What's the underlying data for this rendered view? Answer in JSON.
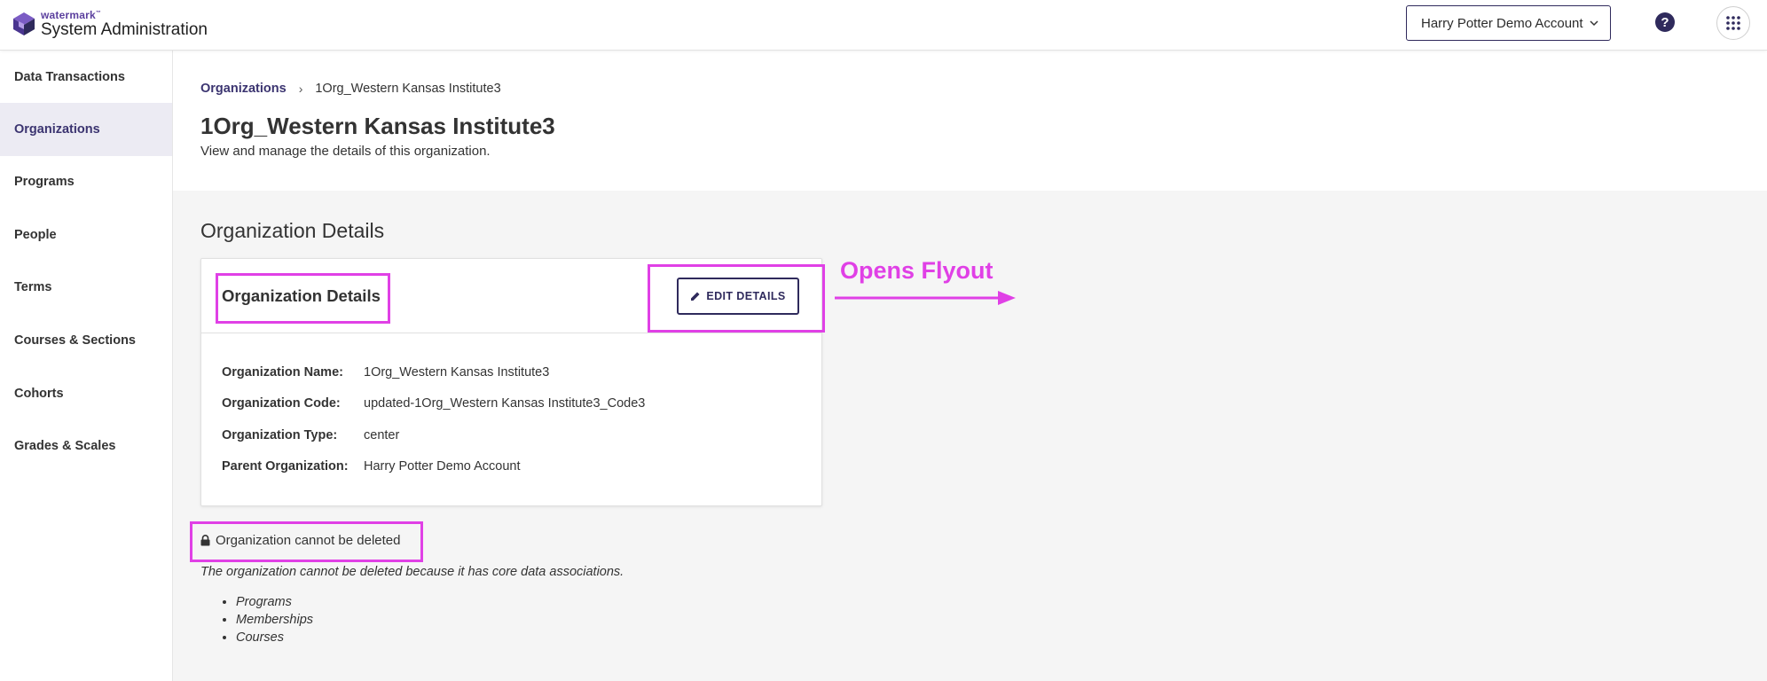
{
  "header": {
    "brand_small": "watermark",
    "brand_tm": "™",
    "brand_title": "System Administration",
    "account_selector": "Harry Potter Demo Account",
    "help_label": "?"
  },
  "sidebar": {
    "items": [
      {
        "label": "Data Transactions",
        "active": false
      },
      {
        "label": "Organizations",
        "active": true
      },
      {
        "label": "Programs",
        "active": false
      },
      {
        "label": "People",
        "active": false
      },
      {
        "label": "Terms",
        "active": false
      },
      {
        "label": "Courses & Sections",
        "active": false
      },
      {
        "label": "Cohorts",
        "active": false
      },
      {
        "label": "Grades & Scales",
        "active": false
      }
    ]
  },
  "breadcrumb": {
    "parent": "Organizations",
    "separator": "›",
    "current": "1Org_Western Kansas Institute3"
  },
  "page": {
    "title": "1Org_Western Kansas Institute3",
    "subtitle": "View and manage the details of this organization."
  },
  "details": {
    "section_title": "Organization Details",
    "card_title": "Organization Details",
    "edit_button": "EDIT DETAILS",
    "rows": [
      {
        "label": "Organization Name:",
        "value": "1Org_Western Kansas Institute3"
      },
      {
        "label": "Organization Code:",
        "value": "updated-1Org_Western Kansas Institute3_Code3"
      },
      {
        "label": "Organization Type:",
        "value": "center"
      },
      {
        "label": "Parent Organization:",
        "value": "Harry Potter Demo Account"
      }
    ]
  },
  "deletion": {
    "status": "Organization cannot be deleted",
    "note": "The organization cannot be deleted because it has core data associations.",
    "associations": [
      "Programs",
      "Memberships",
      "Courses"
    ]
  },
  "annotation": {
    "label": "Opens Flyout",
    "color": "#e040e6"
  },
  "colors": {
    "accent": "#3b3470",
    "active_nav_bg": "#ecebf3",
    "content_bg": "#f5f5f5"
  }
}
